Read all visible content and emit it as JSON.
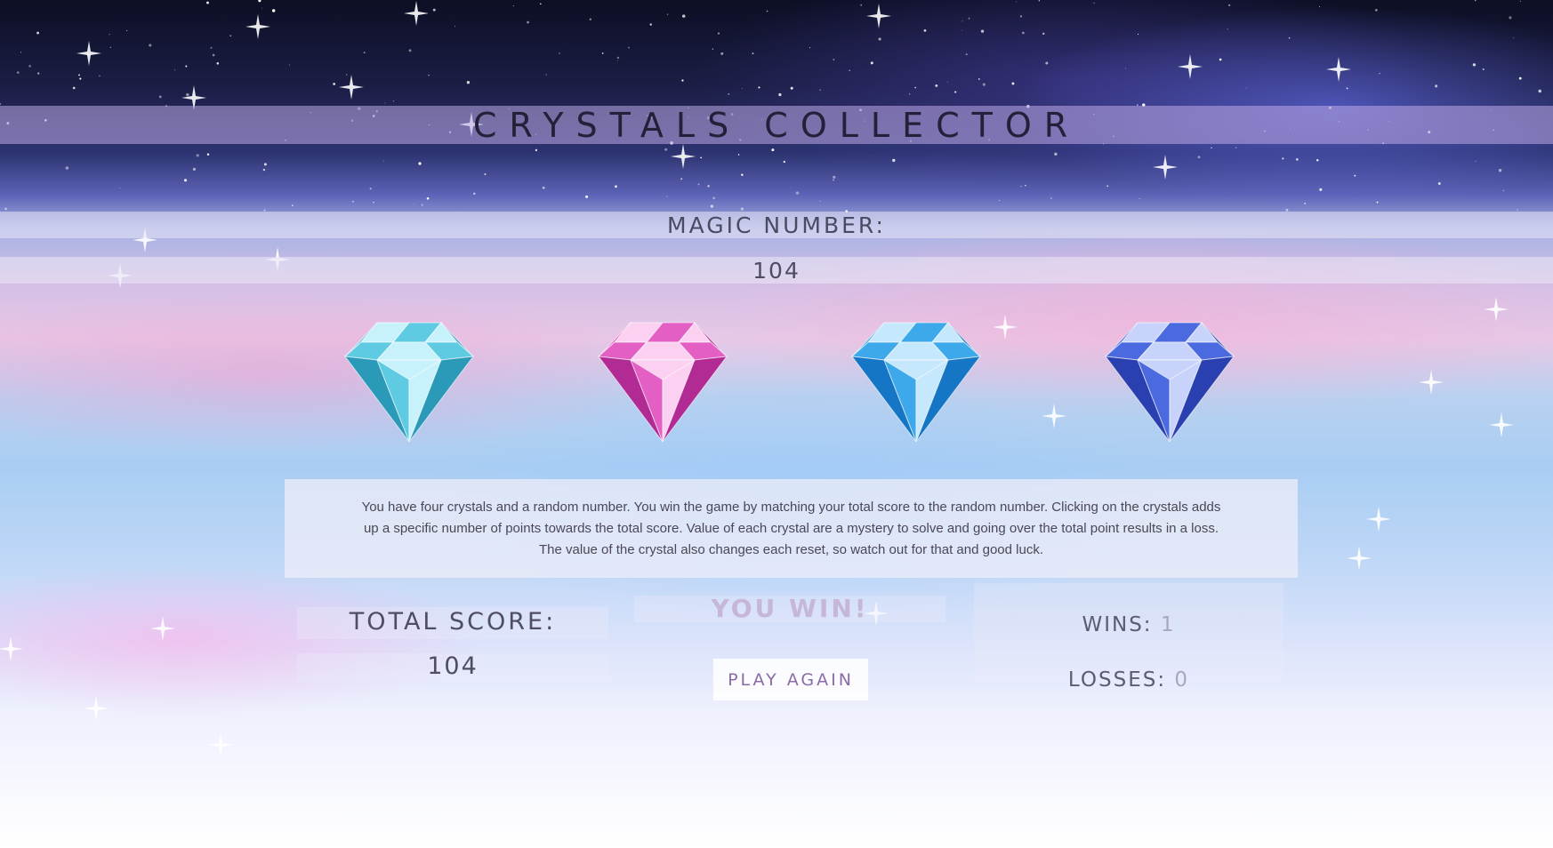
{
  "header": {
    "title": "CRYSTALS COLLECTOR"
  },
  "magic": {
    "label": "MAGIC NUMBER:",
    "value": "104"
  },
  "crystals": [
    {
      "color": "#5fcbe3",
      "dark": "#2a9ab8",
      "light": "#c8f2fb"
    },
    {
      "color": "#e35fc4",
      "dark": "#b22a93",
      "light": "#fbd0f0"
    },
    {
      "color": "#3da9ea",
      "dark": "#1476c4",
      "light": "#c6e8fc"
    },
    {
      "color": "#4c6ae0",
      "dark": "#2a40b0",
      "light": "#c7d3fb"
    }
  ],
  "instructions": "You have four crystals and a random number. You win the game by matching your total score to the random number. Clicking on the crystals adds up a specific number of points towards the total score. Value of each crystal are a mystery to solve and going over the total point results in a loss. The value of the crystal also changes each reset, so watch out for that and good luck.",
  "score": {
    "label": "TOTAL SCORE:",
    "value": "104"
  },
  "status": {
    "message": "YOU WIN!",
    "button": "PLAY AGAIN"
  },
  "stats": {
    "wins_label": "WINS:",
    "wins": "1",
    "losses_label": "LOSSES:",
    "losses": "0"
  }
}
